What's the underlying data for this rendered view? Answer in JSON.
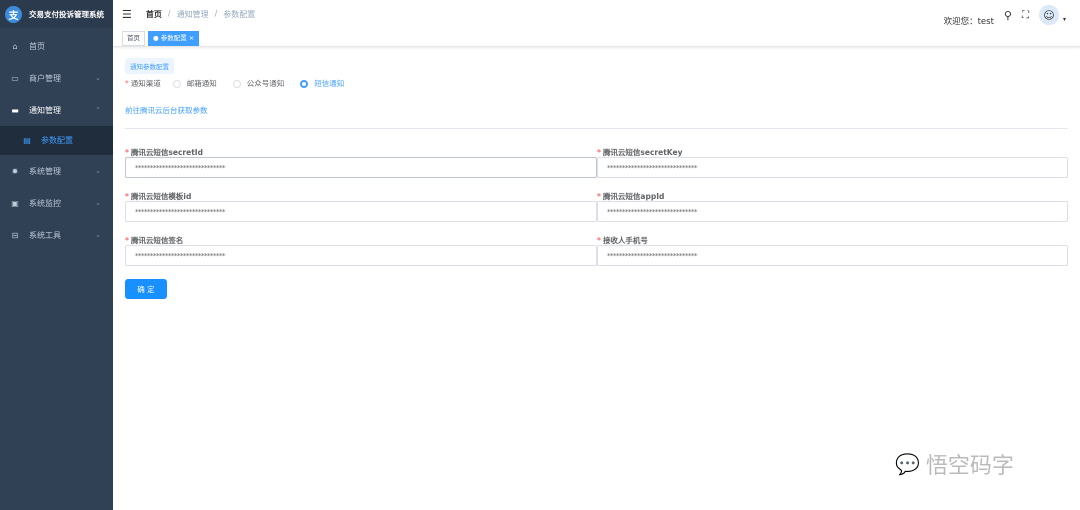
{
  "app": {
    "title": "交易支付投诉管理系统",
    "logo_char": "支"
  },
  "sidebar": {
    "items": [
      {
        "label": "首页",
        "icon": "dashboard-icon",
        "glyph": "⌂"
      },
      {
        "label": "商户管理",
        "icon": "merchant-icon",
        "glyph": "▭",
        "chevron": "⌄"
      },
      {
        "label": "通知管理",
        "icon": "message-icon",
        "glyph": "▬",
        "chevron": "⌃"
      },
      {
        "label": "参数配置",
        "icon": "document-icon",
        "glyph": "▤"
      },
      {
        "label": "系统管理",
        "icon": "gear-icon",
        "glyph": "✹",
        "chevron": "⌄"
      },
      {
        "label": "系统监控",
        "icon": "monitor-icon",
        "glyph": "▣",
        "chevron": "⌄"
      },
      {
        "label": "系统工具",
        "icon": "toolbox-icon",
        "glyph": "⊟",
        "chevron": "⌄"
      }
    ]
  },
  "header": {
    "breadcrumb": [
      "首页",
      "/",
      "通知管理",
      "/",
      "参数配置"
    ],
    "welcome": "欢迎您：test"
  },
  "tags": {
    "home": "首页",
    "active": "● 参数配置 ×"
  },
  "form": {
    "section": "通知参数配置",
    "channel_label": "通知渠道",
    "channels": [
      {
        "label": "邮箱通知",
        "selected": false
      },
      {
        "label": "公众号通知",
        "selected": false
      },
      {
        "label": "短信通知",
        "selected": true
      }
    ],
    "link": "前往腾讯云后台获取参数",
    "fields": [
      {
        "label": "腾讯云短信secretId",
        "value": "******************************"
      },
      {
        "label": "腾讯云短信secretKey",
        "value": "******************************"
      },
      {
        "label": "腾讯云短信模板id",
        "value": "******************************"
      },
      {
        "label": "腾讯云短信appId",
        "value": "******************************"
      },
      {
        "label": "腾讯云短信签名",
        "value": "******************************"
      },
      {
        "label": "接收人手机号",
        "value": "******************************"
      }
    ],
    "submit": "确 定"
  },
  "watermark": "悟空码字",
  "colors": {
    "sidebar": "#304156",
    "accent": "#409eff",
    "required": "#f56c6c"
  }
}
